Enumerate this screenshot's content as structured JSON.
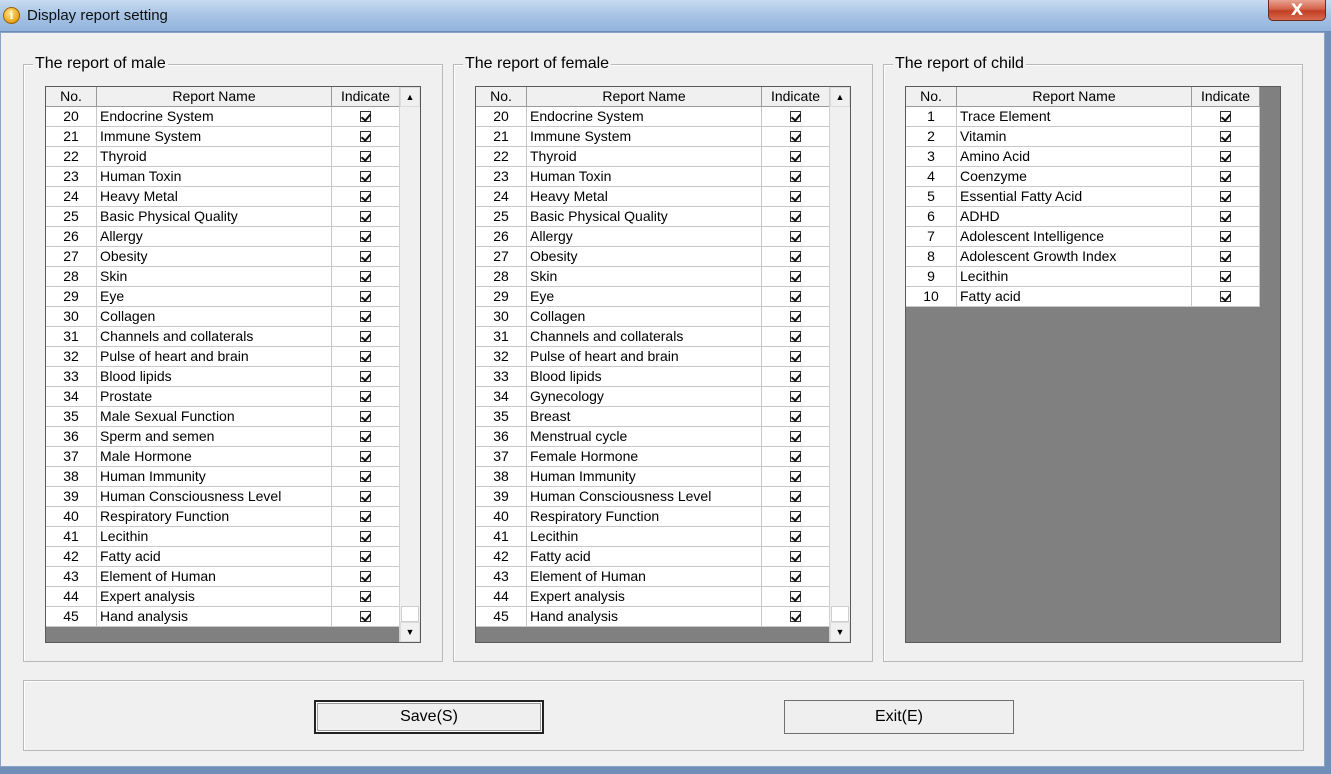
{
  "window": {
    "title": "Display report setting",
    "close_label": "X"
  },
  "columns": {
    "no": "No.",
    "name": "Report Name",
    "indicate": "Indicate"
  },
  "male": {
    "legend": "The report of male",
    "rows": [
      {
        "no": "20",
        "name": "Endocrine System"
      },
      {
        "no": "21",
        "name": "Immune System"
      },
      {
        "no": "22",
        "name": "Thyroid"
      },
      {
        "no": "23",
        "name": "Human Toxin"
      },
      {
        "no": "24",
        "name": "Heavy Metal"
      },
      {
        "no": "25",
        "name": "Basic Physical Quality"
      },
      {
        "no": "26",
        "name": "Allergy"
      },
      {
        "no": "27",
        "name": "Obesity"
      },
      {
        "no": "28",
        "name": "Skin"
      },
      {
        "no": "29",
        "name": "Eye"
      },
      {
        "no": "30",
        "name": "Collagen"
      },
      {
        "no": "31",
        "name": "Channels and collaterals"
      },
      {
        "no": "32",
        "name": "Pulse of heart and brain"
      },
      {
        "no": "33",
        "name": "Blood lipids"
      },
      {
        "no": "34",
        "name": "Prostate"
      },
      {
        "no": "35",
        "name": "Male Sexual Function"
      },
      {
        "no": "36",
        "name": "Sperm and semen"
      },
      {
        "no": "37",
        "name": "Male Hormone"
      },
      {
        "no": "38",
        "name": "Human Immunity"
      },
      {
        "no": "39",
        "name": "Human Consciousness Level"
      },
      {
        "no": "40",
        "name": "Respiratory Function"
      },
      {
        "no": "41",
        "name": "Lecithin"
      },
      {
        "no": "42",
        "name": "Fatty acid"
      },
      {
        "no": "43",
        "name": "Element of Human"
      },
      {
        "no": "44",
        "name": "Expert analysis"
      },
      {
        "no": "45",
        "name": "Hand analysis"
      }
    ]
  },
  "female": {
    "legend": "The report of female",
    "rows": [
      {
        "no": "20",
        "name": "Endocrine System"
      },
      {
        "no": "21",
        "name": "Immune System"
      },
      {
        "no": "22",
        "name": "Thyroid"
      },
      {
        "no": "23",
        "name": "Human Toxin"
      },
      {
        "no": "24",
        "name": "Heavy Metal"
      },
      {
        "no": "25",
        "name": "Basic Physical Quality"
      },
      {
        "no": "26",
        "name": "Allergy"
      },
      {
        "no": "27",
        "name": "Obesity"
      },
      {
        "no": "28",
        "name": "Skin"
      },
      {
        "no": "29",
        "name": "Eye"
      },
      {
        "no": "30",
        "name": "Collagen"
      },
      {
        "no": "31",
        "name": "Channels and collaterals"
      },
      {
        "no": "32",
        "name": "Pulse of heart and brain"
      },
      {
        "no": "33",
        "name": "Blood lipids"
      },
      {
        "no": "34",
        "name": "Gynecology"
      },
      {
        "no": "35",
        "name": "Breast"
      },
      {
        "no": "36",
        "name": "Menstrual cycle"
      },
      {
        "no": "37",
        "name": "Female Hormone"
      },
      {
        "no": "38",
        "name": "Human Immunity"
      },
      {
        "no": "39",
        "name": "Human Consciousness Level"
      },
      {
        "no": "40",
        "name": "Respiratory Function"
      },
      {
        "no": "41",
        "name": "Lecithin"
      },
      {
        "no": "42",
        "name": "Fatty acid"
      },
      {
        "no": "43",
        "name": "Element of Human"
      },
      {
        "no": "44",
        "name": "Expert analysis"
      },
      {
        "no": "45",
        "name": "Hand analysis"
      }
    ]
  },
  "child": {
    "legend": "The report of child",
    "rows": [
      {
        "no": "1",
        "name": "Trace Element"
      },
      {
        "no": "2",
        "name": "Vitamin"
      },
      {
        "no": "3",
        "name": "Amino Acid"
      },
      {
        "no": "4",
        "name": "Coenzyme"
      },
      {
        "no": "5",
        "name": "Essential Fatty Acid"
      },
      {
        "no": "6",
        "name": "ADHD"
      },
      {
        "no": "7",
        "name": "Adolescent Intelligence"
      },
      {
        "no": "8",
        "name": "Adolescent Growth Index"
      },
      {
        "no": "9",
        "name": "Lecithin"
      },
      {
        "no": "10",
        "name": "Fatty acid"
      }
    ]
  },
  "buttons": {
    "save": "Save(S)",
    "exit": "Exit(E)"
  },
  "icons": {
    "title": "info-icon",
    "checkbox": "checkmark-icon"
  },
  "colors": {
    "grid_background": "#808080",
    "title_bar": "#a9c5e6",
    "close_button": "#c23f22"
  }
}
